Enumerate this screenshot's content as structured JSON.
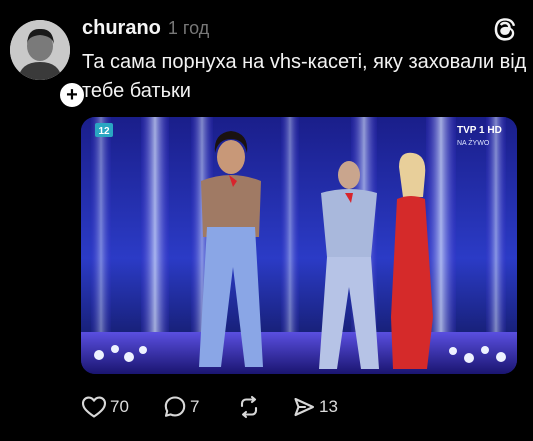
{
  "post": {
    "username": "churano",
    "timestamp": "1 год",
    "caption": "Та сама порнуха на vhs-касеті, яку заховали від тебе батьки"
  },
  "media": {
    "channel_badge": "12",
    "broadcaster_logo": "TVP 1 HD",
    "live_label": "NA ŻYWO"
  },
  "icons": {
    "avatar": "avatar",
    "follow": "plus-icon",
    "app": "threads-icon",
    "like": "heart-icon",
    "reply": "comment-icon",
    "repost": "repost-icon",
    "share": "send-icon"
  },
  "actions": {
    "like_count": "70",
    "reply_count": "7",
    "share_count": "13"
  },
  "colors": {
    "background": "#000000",
    "text": "#f3f3f3",
    "muted": "#777777"
  }
}
